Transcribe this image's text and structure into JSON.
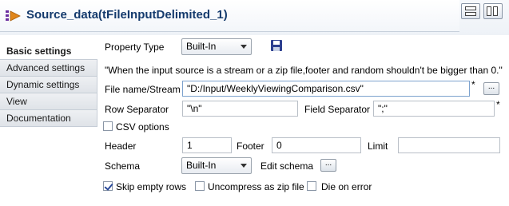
{
  "header": {
    "title": "Source_data(tFileInputDelimited_1)"
  },
  "sidebar": {
    "items": [
      {
        "label": "Basic settings"
      },
      {
        "label": "Advanced settings"
      },
      {
        "label": "Dynamic settings"
      },
      {
        "label": "View"
      },
      {
        "label": "Documentation"
      }
    ]
  },
  "form": {
    "property_type_label": "Property Type",
    "property_type_value": "Built-In",
    "notice": "\"When the input source is a stream or a zip file,footer and random shouldn't be bigger than 0.\"",
    "file_name_label": "File name/Stream",
    "file_name_value": "\"D:/Input/WeeklyViewingComparison.csv\"",
    "row_separator_label": "Row Separator",
    "row_separator_value": "\"\\n\"",
    "field_separator_label": "Field Separator",
    "field_separator_value": "\";\"",
    "required_mark": "*",
    "csv_options_label": "CSV options",
    "csv_options_checked": false,
    "header_label": "Header",
    "header_value": "1",
    "footer_label": "Footer",
    "footer_value": "0",
    "limit_label": "Limit",
    "limit_value": "",
    "schema_label": "Schema",
    "schema_value": "Built-In",
    "edit_schema_label": "Edit schema",
    "browse_label": "...",
    "skip_empty_rows_label": "Skip empty rows",
    "skip_empty_rows_checked": true,
    "uncompress_label": "Uncompress as zip file",
    "uncompress_checked": false,
    "die_on_error_label": "Die on error",
    "die_on_error_checked": false
  },
  "icons": {
    "component": "component-icon",
    "save": "save-icon",
    "view_modes": [
      "single-view-icon",
      "split-view-icon"
    ]
  }
}
